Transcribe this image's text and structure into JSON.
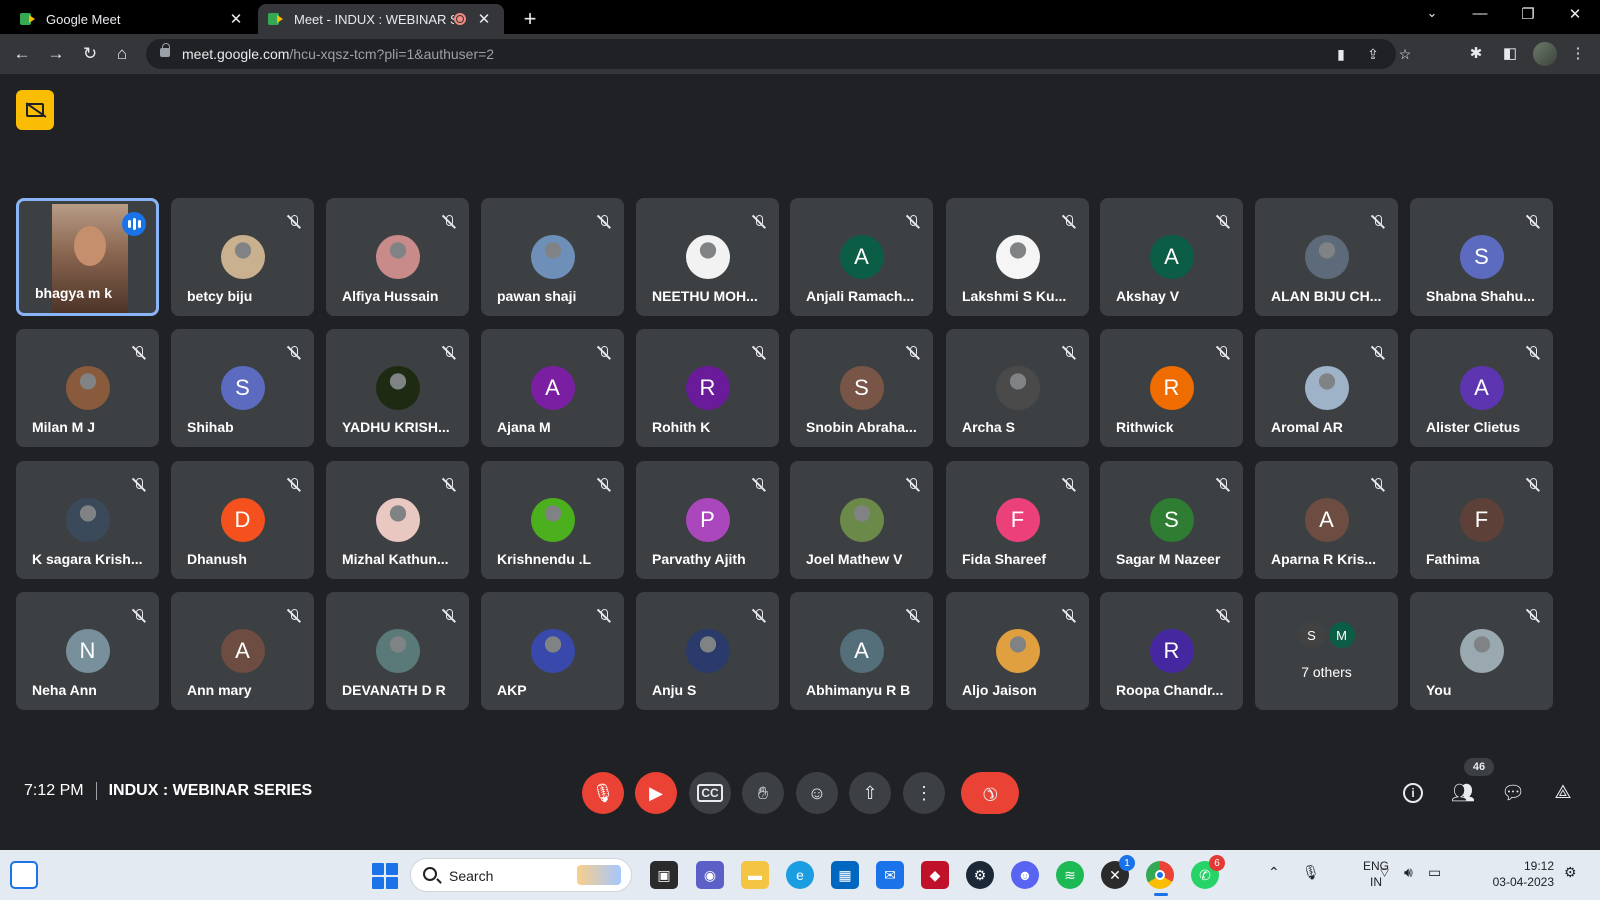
{
  "browser": {
    "tabs": [
      {
        "title": "Google Meet",
        "active": false
      },
      {
        "title": "Meet - INDUX : WEBINAR SE",
        "active": true
      }
    ],
    "url_host": "meet.google.com",
    "url_path": "/hcu-xqsz-tcm?pli=1&authuser=2"
  },
  "meeting": {
    "time": "7:12 PM",
    "name": "INDUX : WEBINAR SERIES",
    "people_count": "46",
    "others_label": "7 others",
    "others_initials": [
      "S",
      "M"
    ]
  },
  "participants": [
    {
      "name": "bhagya m k",
      "type": "video"
    },
    {
      "name": "betcy biju",
      "type": "photo",
      "color": "#c9b08e"
    },
    {
      "name": "Alfiya Hussain",
      "type": "photo",
      "color": "#c98a8a"
    },
    {
      "name": "pawan shaji",
      "type": "photo",
      "color": "#6d8fb8"
    },
    {
      "name": "NEETHU MOH...",
      "type": "photo",
      "color": "#f2f2f2"
    },
    {
      "name": "Anjali Ramach...",
      "initial": "A",
      "color": "#0b5e45"
    },
    {
      "name": "Lakshmi S Ku...",
      "type": "photo",
      "color": "#f5f5f5"
    },
    {
      "name": "Akshay V",
      "initial": "A",
      "color": "#0b5e45"
    },
    {
      "name": "ALAN BIJU CH...",
      "type": "photo",
      "color": "#5d6a7a"
    },
    {
      "name": "Shabna Shahu...",
      "initial": "S",
      "color": "#5c6bc0"
    },
    {
      "name": "Milan M J",
      "type": "photo",
      "color": "#8a5a3c"
    },
    {
      "name": "Shihab",
      "initial": "S",
      "color": "#5c6bc0"
    },
    {
      "name": "YADHU KRISH...",
      "type": "photo",
      "color": "#1e2a12"
    },
    {
      "name": "Ajana M",
      "initial": "A",
      "color": "#7b1fa2"
    },
    {
      "name": "Rohith K",
      "initial": "R",
      "color": "#6a1b9a"
    },
    {
      "name": "Snobin Abraha...",
      "initial": "S",
      "color": "#795548"
    },
    {
      "name": "Archa S",
      "type": "photo",
      "color": "#4a4a4a"
    },
    {
      "name": "Rithwick",
      "initial": "R",
      "color": "#ef6c00"
    },
    {
      "name": "Aromal AR",
      "type": "photo",
      "color": "#9fb3c8"
    },
    {
      "name": "Alister Clietus",
      "initial": "A",
      "color": "#5e35b1"
    },
    {
      "name": "K sagara Krish...",
      "type": "photo",
      "color": "#3a4a5a"
    },
    {
      "name": "Dhanush",
      "initial": "D",
      "color": "#f4511e"
    },
    {
      "name": "Mizhal Kathun...",
      "type": "photo",
      "color": "#e8c8c0"
    },
    {
      "name": "Krishnendu .L",
      "type": "photo",
      "color": "#4caf1e"
    },
    {
      "name": "Parvathy Ajith",
      "initial": "P",
      "color": "#ab47bc"
    },
    {
      "name": "Joel Mathew V",
      "type": "photo",
      "color": "#6b8a4a"
    },
    {
      "name": "Fida Shareef",
      "initial": "F",
      "color": "#ec407a"
    },
    {
      "name": "Sagar M Nazeer",
      "initial": "S",
      "color": "#2e7d32"
    },
    {
      "name": "Aparna R Kris...",
      "initial": "A",
      "color": "#6d4c41"
    },
    {
      "name": "Fathima",
      "initial": "F",
      "color": "#5d4037"
    },
    {
      "name": "Neha Ann",
      "initial": "N",
      "color": "#78909c"
    },
    {
      "name": "Ann mary",
      "initial": "A",
      "color": "#6d4c41"
    },
    {
      "name": "DEVANATH D R",
      "type": "photo",
      "color": "#5a7a7a"
    },
    {
      "name": "AKP",
      "type": "photo",
      "color": "#3949ab"
    },
    {
      "name": "Anju S",
      "type": "photo",
      "color": "#2a3a6a"
    },
    {
      "name": "Abhimanyu R B",
      "initial": "A",
      "color": "#546e7a"
    },
    {
      "name": "Aljo Jaison",
      "type": "photo",
      "color": "#e0a040"
    },
    {
      "name": "Roopa Chandr...",
      "initial": "R",
      "color": "#4527a0"
    },
    {
      "name": "7 others",
      "type": "others"
    },
    {
      "name": "You",
      "type": "photo",
      "color": "#9aa8b0"
    }
  ],
  "taskbar": {
    "search_label": "Search",
    "lang_top": "ENG",
    "lang_bottom": "IN",
    "time": "19:12",
    "date": "03-04-2023",
    "xbox_badge": "1",
    "whatsapp_badge": "6"
  },
  "colors": {
    "meet_bg": "#202124",
    "tile_bg": "#3c4043",
    "danger": "#ea4335",
    "speaking_border": "#8ab4f8",
    "host_badge": "#fbbc04"
  }
}
